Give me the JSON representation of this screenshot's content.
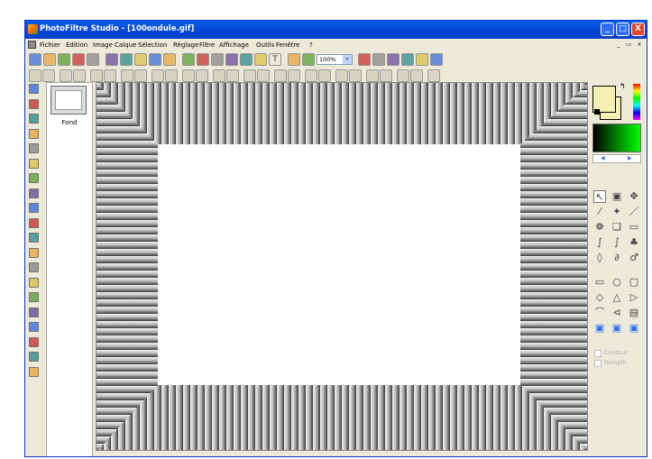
{
  "window": {
    "title": "PhotoFiltre Studio - [100ondule.gif]",
    "minimize": "_",
    "maximize": "□",
    "close": "X"
  },
  "menu": [
    "Fichier",
    "Edition",
    "Image",
    "Calque",
    "Sélection",
    "Réglage",
    "Filtre",
    "Affichage",
    "Outils",
    "Fenêtre",
    "?"
  ],
  "mdi_controls": "_ ▭ x",
  "toolbar": {
    "zoom": "100%",
    "zoom_dropdown": "▾",
    "text_tool": "T"
  },
  "layers": {
    "items": [
      {
        "name": "Fond"
      }
    ]
  },
  "colors": {
    "foreground": "#f4efb3",
    "background": "#f4efb3",
    "gradient_start": "#000000",
    "gradient_end": "#00ff00",
    "accent": "#0245d6"
  },
  "gradient_nav": {
    "prev": "◀",
    "next": "▶"
  },
  "right_tools": {
    "options": [
      {
        "label": "Contour",
        "checked": false
      },
      {
        "label": "Remplir",
        "checked": false
      }
    ]
  },
  "icons": {
    "toolbar1": [
      "new-icon",
      "open-icon",
      "save-icon",
      "print-icon",
      "scan-icon",
      "undo-icon",
      "redo-icon",
      "copy-icon",
      "paste-icon",
      "paste-new-icon",
      "layer-icon",
      "color-icon",
      "contrast-icon",
      "sharpen-icon",
      "resize-icon",
      "crop-icon",
      "text-icon",
      "tree-icon",
      "bird-icon",
      "frame-icon",
      "zoom-in-icon",
      "zoom-out-icon",
      "fit-icon",
      "grid-icon",
      "screen-icon"
    ],
    "toolbar2": [
      "auto-levels-icon",
      "auto-contrast-icon",
      "brightness-down-icon",
      "brightness-up-icon",
      "contrast-down-icon",
      "contrast-up-icon",
      "gamma-down-icon",
      "gamma-up-icon",
      "saturation-down-icon",
      "saturation-up-icon",
      "grayscale-icon",
      "filter-a-icon",
      "filter-b-icon",
      "filter-c-icon",
      "blur-icon",
      "drop-icon",
      "sharpen-a-icon",
      "sharpen-b-icon",
      "relief-icon",
      "deform-icon",
      "mirror-h-icon",
      "mirror-v-icon",
      "rotate-icon",
      "flip-h-icon",
      "flip-v-icon",
      "plugin-a-icon",
      "plugin-b-icon"
    ],
    "left": [
      "image-info-icon",
      "layer-manager-icon",
      "selection-icon",
      "stamp-icon",
      "sphere-icon",
      "grid-palette-icon",
      "star-icon",
      "page-icon",
      "gray-square-icon",
      "script-icon",
      "link-icon",
      "mosaic-icon",
      "histogram-icon",
      "circle-icon",
      "package-icon",
      "save-disk-icon",
      "save-as-icon",
      "page-small-icon",
      "folder-arrow-icon",
      "folder-print-icon"
    ],
    "right": [
      "pointer-icon",
      "hand-select-icon",
      "move-icon",
      "dropper-icon",
      "magic-wand-icon",
      "line-icon",
      "spray-icon",
      "bucket-icon",
      "eraser-icon",
      "brush-icon",
      "smudge-icon",
      "stamp-tool-icon",
      "blur-drop-icon",
      "finger-icon",
      "pen-icon",
      "rectangle-icon",
      "ellipse-icon",
      "rounded-rect-icon",
      "diamond-icon",
      "triangle-icon",
      "triangle-right-icon",
      "lasso-icon",
      "polygon-lasso-icon",
      "folder-open-icon",
      "fill-icon",
      "clone-icon",
      "pattern-icon"
    ]
  }
}
